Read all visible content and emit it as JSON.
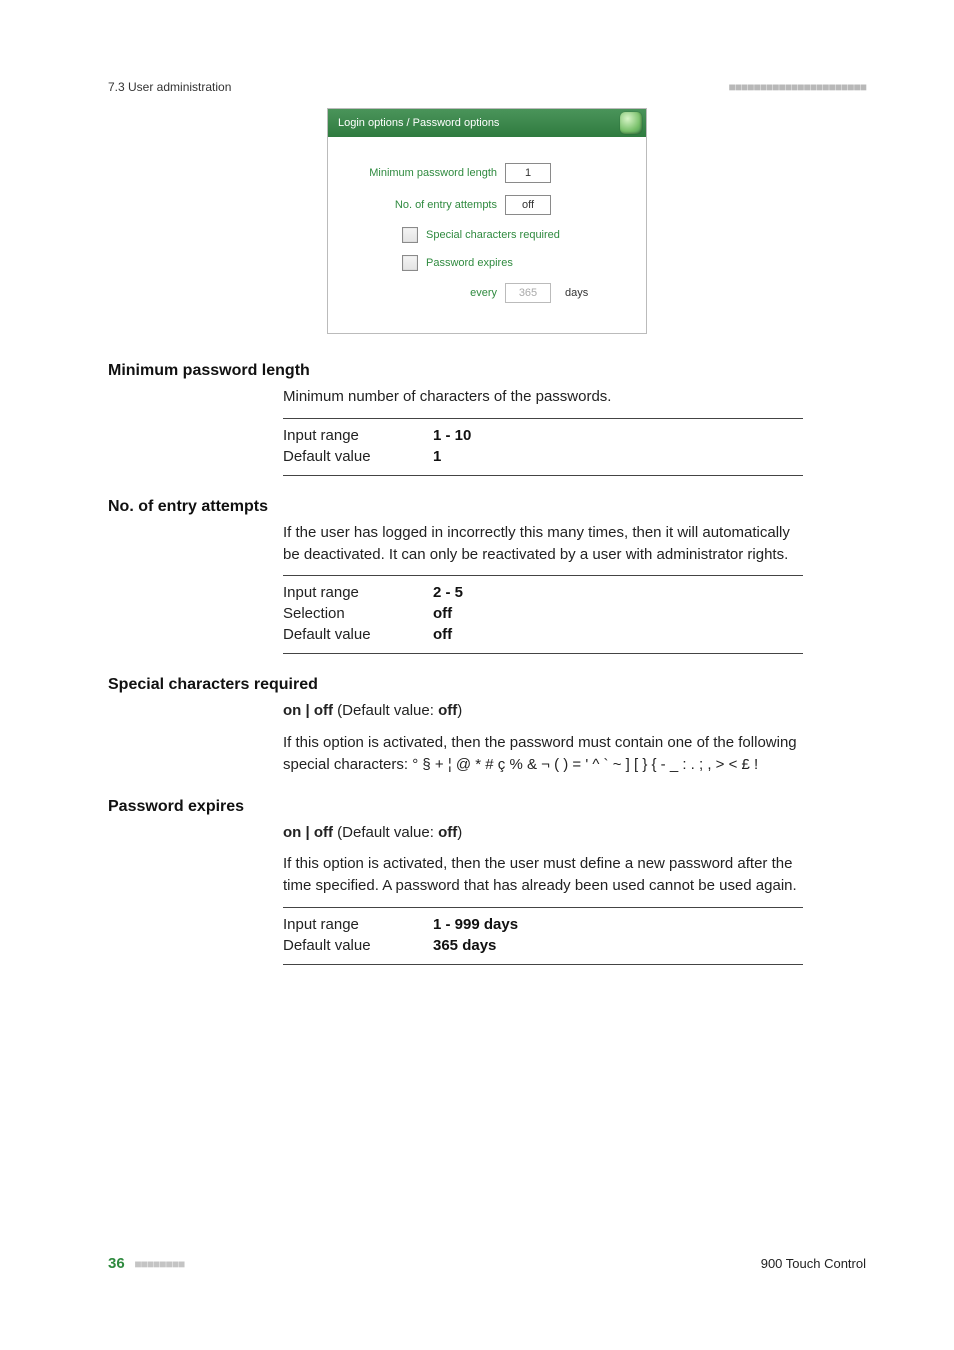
{
  "header": {
    "section": "7.3 User administration",
    "dashes": "■■■■■■■■■■■■■■■■■■■■■■"
  },
  "screenshot": {
    "title": "Login options / Password options",
    "rows": {
      "min_pwd_label": "Minimum password length",
      "min_pwd_value": "1",
      "entry_attempts_label": "No. of entry attempts",
      "entry_attempts_value": "off",
      "special_label": "Special characters required",
      "expires_label": "Password expires",
      "every_label": "every",
      "every_value": "365",
      "every_unit": "days"
    }
  },
  "sections": {
    "min_pwd": {
      "title": "Minimum password length",
      "desc": "Minimum number of characters of the passwords.",
      "table": {
        "r1k": "Input range",
        "r1v": "1 - 10",
        "r2k": "Default value",
        "r2v": "1"
      }
    },
    "entry_attempts": {
      "title": "No. of entry attempts",
      "desc": "If the user has logged in incorrectly this many times, then it will automatically be deactivated. It can only be reactivated by a user with administrator rights.",
      "table": {
        "r1k": "Input range",
        "r1v": "2 - 5",
        "r2k": "Selection",
        "r2v": "off",
        "r3k": "Default value",
        "r3v": "off"
      }
    },
    "special_chars": {
      "title": "Special characters required",
      "on_off_prefix": "on | off",
      "default_label": " (Default value: ",
      "default_value": "off",
      "default_close": ")",
      "desc": "If this option is activated, then the password must contain one of the following special characters: ° § + ¦ @ * # ç % & ¬ ( ) = ' ^ ` ~ ] [ } { - _ : . ; , > < £ !"
    },
    "pwd_expires": {
      "title": "Password expires",
      "on_off_prefix": "on | off",
      "default_label": " (Default value: ",
      "default_value": "off",
      "default_close": ")",
      "desc": "If this option is activated, then the user must define a new password after the time specified. A password that has already been used cannot be used again.",
      "table": {
        "r1k": "Input range",
        "r1v": "1 - 999 days",
        "r2k": "Default value",
        "r2v": "365 days"
      }
    }
  },
  "footer": {
    "page": "36",
    "dashes": "■■■■■■■■",
    "right": "900 Touch Control"
  }
}
